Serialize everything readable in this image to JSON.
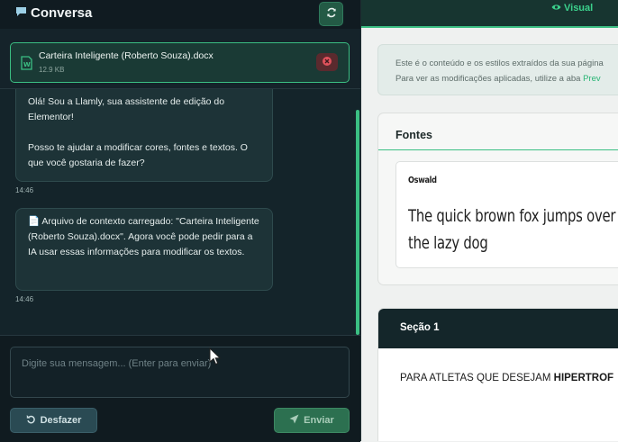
{
  "chat": {
    "title": "Conversa",
    "title_icon": "speech-bubble-icon",
    "refresh_icon": "refresh-icon",
    "file": {
      "name": "Carteira Inteligente (Roberto Souza).docx",
      "size": "12.9 KB",
      "icon": "word-file-icon"
    },
    "messages": [
      {
        "text": "Olá! Sou a Llamly, sua assistente de edição do Elementor!\n\nPosso te ajudar a modificar cores, fontes e textos. O que você gostaria de fazer?",
        "time": "14:46"
      },
      {
        "text": "📄 Arquivo de contexto carregado: \"Carteira Inteligente (Roberto Souza).docx\". Agora você pode pedir para a IA usar essas informações para modificar os textos.",
        "time": "14:46"
      }
    ],
    "input_placeholder": "Digite sua mensagem... (Enter para enviar)",
    "undo_label": "Desfazer",
    "send_label": "Enviar"
  },
  "preview": {
    "tab_label": "Visual",
    "info_line1": "Este é o conteúdo e os estilos extraídos da sua página",
    "info_line2_prefix": "Para ver as modificações aplicadas, utilize a aba ",
    "info_line2_link": "Prev",
    "fonts_heading": "Fontes",
    "font_name": "Oswald",
    "font_sample": "The quick brown fox jumps over the lazy dog",
    "section_title": "Seção 1",
    "section_text_normal": "PARA ATLETAS QUE DESEJAM ",
    "section_text_bold": "HIPERTROF"
  },
  "colors": {
    "accent": "#3bbf83",
    "chat_bg": "#15232a",
    "preview_bg": "#eff1f0",
    "danger": "#e0525c"
  }
}
